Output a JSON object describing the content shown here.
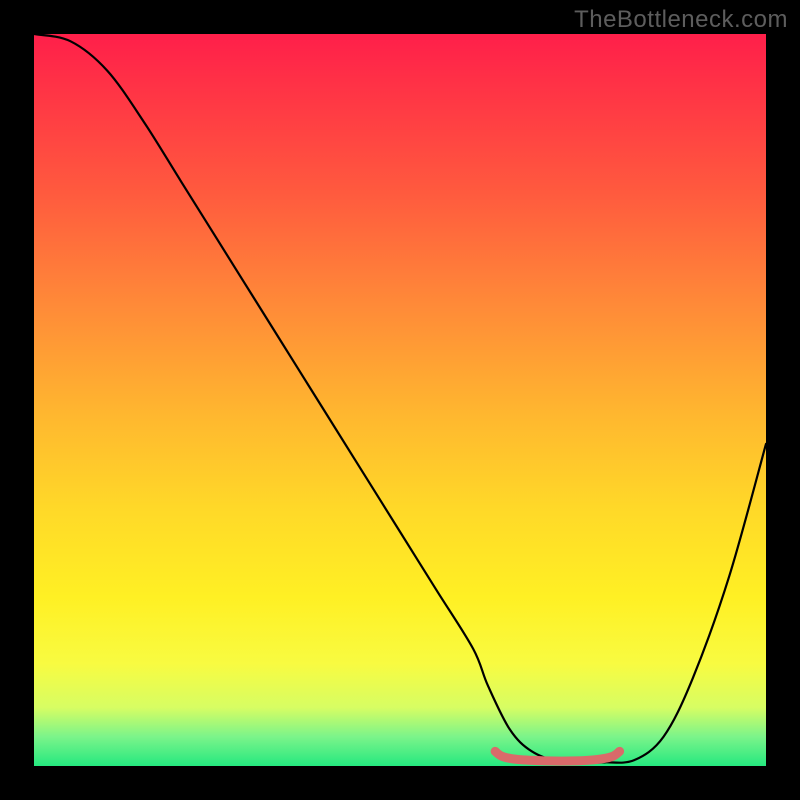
{
  "watermark": "TheBottleneck.com",
  "chart_data": {
    "type": "line",
    "title": "",
    "xlabel": "",
    "ylabel": "",
    "xlim": [
      0,
      100
    ],
    "ylim": [
      0,
      100
    ],
    "series": [
      {
        "name": "curve",
        "x": [
          0,
          5,
          10,
          15,
          20,
          25,
          30,
          35,
          40,
          45,
          50,
          55,
          60,
          62,
          65,
          68,
          72,
          75,
          78,
          82,
          86,
          90,
          95,
          100
        ],
        "y": [
          100,
          99,
          95,
          88,
          80,
          72,
          64,
          56,
          48,
          40,
          32,
          24,
          16,
          11,
          5,
          2,
          0.5,
          0.5,
          0.5,
          0.8,
          4,
          12,
          26,
          44
        ]
      },
      {
        "name": "optimal-range-marker",
        "x": [
          63,
          64,
          66,
          70,
          74,
          77,
          79,
          80
        ],
        "y": [
          2.0,
          1.3,
          0.9,
          0.7,
          0.7,
          0.9,
          1.3,
          2.0
        ]
      }
    ],
    "colors": {
      "curve": "#000000",
      "marker": "#d96a6a",
      "gradient_top": "#ff1f4a",
      "gradient_mid": "#ffd928",
      "gradient_bottom": "#25e87f"
    }
  }
}
